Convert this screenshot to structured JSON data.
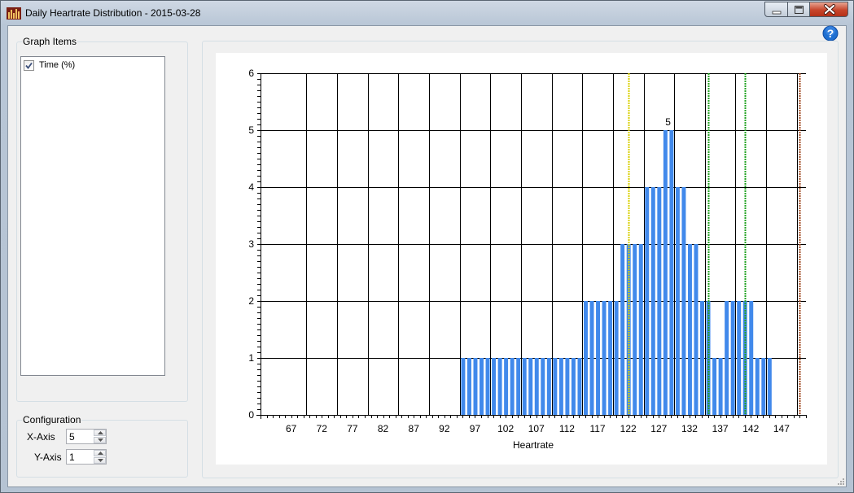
{
  "window": {
    "title": "Daily Heartrate Distribution - 2015-03-28"
  },
  "graph_items": {
    "legend": "Graph Items",
    "items": [
      {
        "label": "Time (%)",
        "checked": true
      }
    ]
  },
  "configuration": {
    "legend": "Configuration",
    "x_axis_label": "X-Axis",
    "x_axis_value": "5",
    "y_axis_label": "Y-Axis",
    "y_axis_value": "1"
  },
  "icons": {
    "app": "bar-chart-icon",
    "help": "help-icon",
    "minimize": "minimize-icon",
    "maximize": "maximize-icon",
    "close": "close-icon"
  },
  "colors": {
    "bar": "#4189eb",
    "yellow_line": "#d8d000",
    "green_line": "#22a322",
    "brown_line": "#a04a22",
    "help": "#1f6fd1"
  },
  "chart_data": {
    "type": "bar",
    "title": "",
    "xlabel": "Heartrate",
    "ylabel": "",
    "xlim": [
      62,
      151
    ],
    "ylim": [
      0,
      6
    ],
    "x_ticks": [
      67,
      72,
      77,
      82,
      87,
      92,
      97,
      102,
      107,
      112,
      117,
      122,
      127,
      132,
      137,
      142,
      147
    ],
    "y_ticks": [
      0,
      1,
      2,
      3,
      4,
      5,
      6
    ],
    "grid": true,
    "legend": "none",
    "series": [
      {
        "x": [
          95,
          96,
          97,
          98,
          99,
          100,
          101,
          102,
          103,
          104,
          105,
          106,
          107,
          108,
          109,
          110,
          111,
          112,
          113,
          114,
          115,
          116,
          117,
          118,
          119,
          120,
          121,
          122,
          123,
          124,
          125,
          126,
          127,
          128,
          129,
          130,
          131,
          132,
          133,
          134,
          135,
          136,
          137,
          138,
          139,
          140,
          141,
          142,
          143,
          144,
          145
        ],
        "values": [
          1,
          1,
          1,
          1,
          1,
          1,
          1,
          1,
          1,
          1,
          1,
          1,
          1,
          1,
          1,
          1,
          1,
          1,
          1,
          1,
          2,
          2,
          2,
          2,
          2,
          2,
          3,
          3,
          3,
          3,
          4,
          4,
          4,
          5,
          5,
          4,
          4,
          3,
          3,
          2,
          2,
          1,
          1,
          2,
          2,
          2,
          2,
          2,
          1,
          1,
          1
        ]
      }
    ],
    "point_labels": [
      {
        "x": 128.5,
        "y": 5,
        "text": "5"
      }
    ],
    "reference_lines": [
      {
        "x": 122,
        "color": "yellow"
      },
      {
        "x": 135,
        "color": "green"
      },
      {
        "x": 141,
        "color": "green"
      },
      {
        "x": 150,
        "color": "brown"
      }
    ]
  }
}
